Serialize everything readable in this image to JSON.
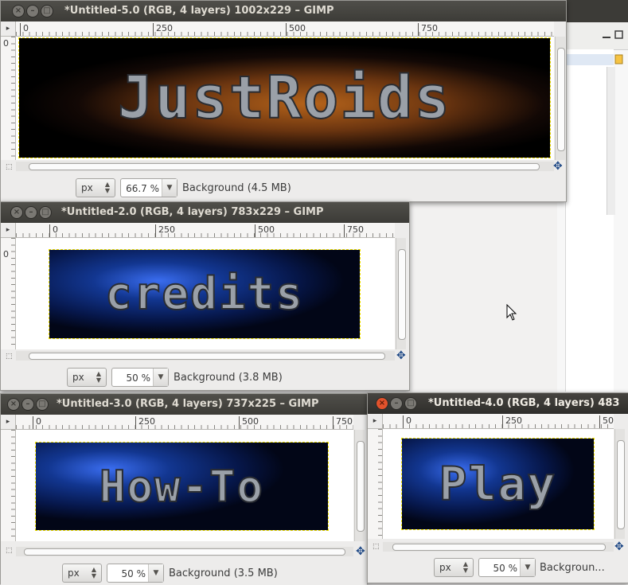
{
  "windows": [
    {
      "id": "w5",
      "title": "*Untitled-5.0 (RGB, 4 layers) 1002x229 – GIMP",
      "active": false,
      "ruler_ticks": [
        "0",
        "250",
        "500",
        "750"
      ],
      "vruler_ticks": [
        "0"
      ],
      "art_text": "JustRoids",
      "unit": "px",
      "zoom": "66.7 %",
      "status": "Background (4.5 MB)"
    },
    {
      "id": "w2",
      "title": "*Untitled-2.0 (RGB, 4 layers) 783x229 – GIMP",
      "active": false,
      "ruler_ticks": [
        "0",
        "250",
        "500",
        "750"
      ],
      "vruler_ticks": [
        "0"
      ],
      "art_text": "credits",
      "unit": "px",
      "zoom": "50 %",
      "status": "Background (3.8 MB)"
    },
    {
      "id": "w3",
      "title": "*Untitled-3.0 (RGB, 4 layers) 737x225 – GIMP",
      "active": false,
      "ruler_ticks": [
        "0",
        "250",
        "500",
        "750"
      ],
      "vruler_ticks": [],
      "art_text": "How-To",
      "unit": "px",
      "zoom": "50 %",
      "status": "Background (3.5 MB)"
    },
    {
      "id": "w4",
      "title": "*Untitled-4.0 (RGB, 4 layers) 483",
      "active": true,
      "ruler_ticks": [
        "0",
        "250",
        "50"
      ],
      "vruler_ticks": [],
      "art_text": "Play",
      "unit": "px",
      "zoom": "50 %",
      "status": "Backgroun..."
    }
  ],
  "colors": {
    "glow_orange": "#e07a1a",
    "glow_blue": "#1a3fb0",
    "selection_outline": "#f2e200",
    "titlebar": "#3c3b37",
    "close_active": "#e2522c"
  }
}
